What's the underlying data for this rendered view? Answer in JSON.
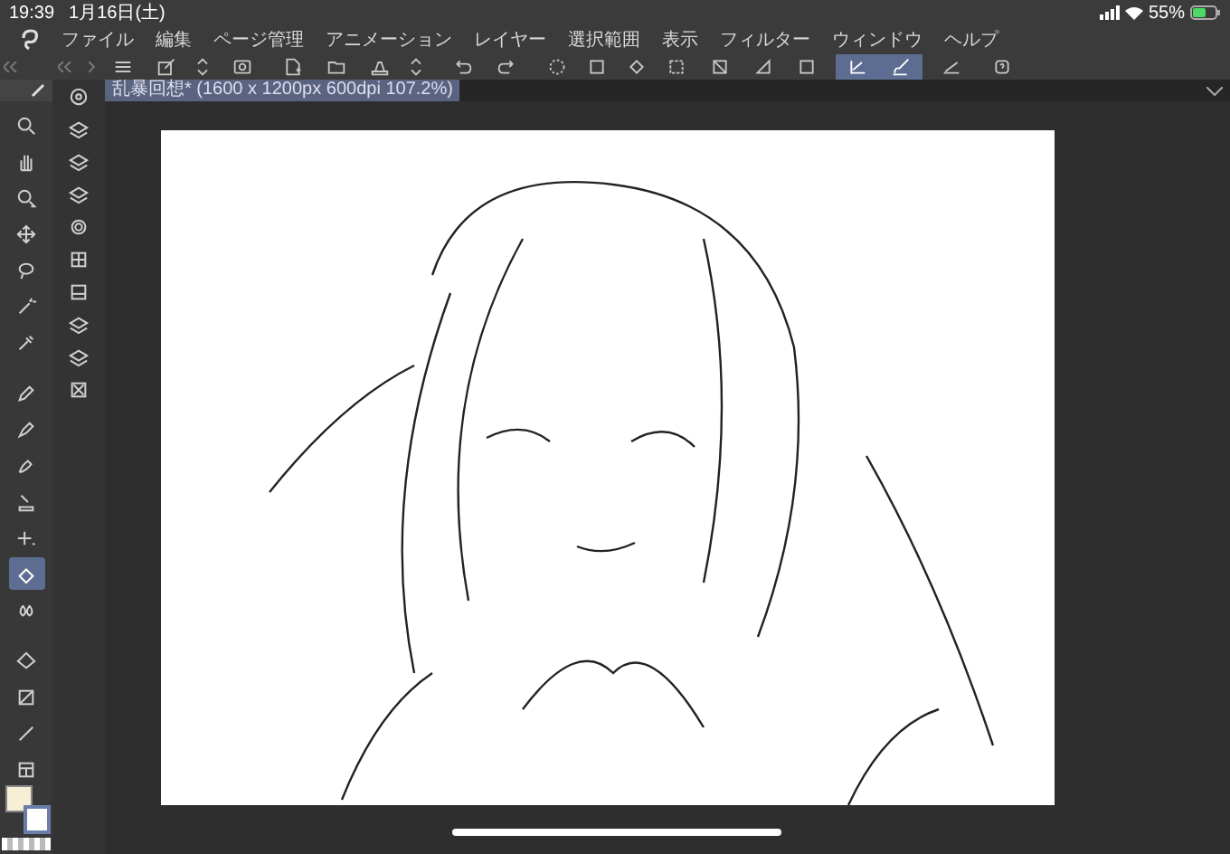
{
  "status_bar": {
    "time": "19:39",
    "date": "1月16日(土)",
    "battery": "55%"
  },
  "menu_bar": {
    "items": [
      "ファイル",
      "編集",
      "ページ管理",
      "アニメーション",
      "レイヤー",
      "選択範囲",
      "表示",
      "フィルター",
      "ウィンドウ",
      "ヘルプ"
    ]
  },
  "command_bar": {
    "buttons": [
      {
        "selected": false
      },
      {
        "selected": false
      },
      {
        "selected": false
      },
      {
        "selected": false
      },
      {
        "selected": false
      },
      {
        "selected": false
      },
      {
        "selected": false
      },
      {
        "selected": false
      },
      {
        "selected": false
      },
      {
        "selected": false
      },
      {
        "selected": false
      },
      {
        "selected": false
      },
      {
        "selected": false
      },
      {
        "selected": false
      },
      {
        "selected": false
      },
      {
        "selected": false
      },
      {
        "selected": false
      },
      {
        "selected": true
      },
      {
        "selected": true
      },
      {
        "selected": false
      },
      {
        "selected": false
      }
    ]
  },
  "tool_palette": {
    "tools": [
      {
        "selected": false
      },
      {
        "selected": false
      },
      {
        "selected": false
      },
      {
        "selected": false
      },
      {
        "selected": false
      },
      {
        "selected": false
      },
      {
        "selected": false
      },
      {
        "selected": false
      },
      {
        "selected": false
      },
      {
        "selected": false
      },
      {
        "selected": false
      },
      {
        "selected": false
      },
      {
        "selected": true
      },
      {
        "selected": false
      },
      {
        "selected": false
      },
      {
        "selected": false
      },
      {
        "selected": false
      },
      {
        "selected": false
      }
    ]
  },
  "canvas_tab": {
    "title": "乱暴回想* (1600 x 1200px 600dpi 107.2%)",
    "selected": true
  }
}
